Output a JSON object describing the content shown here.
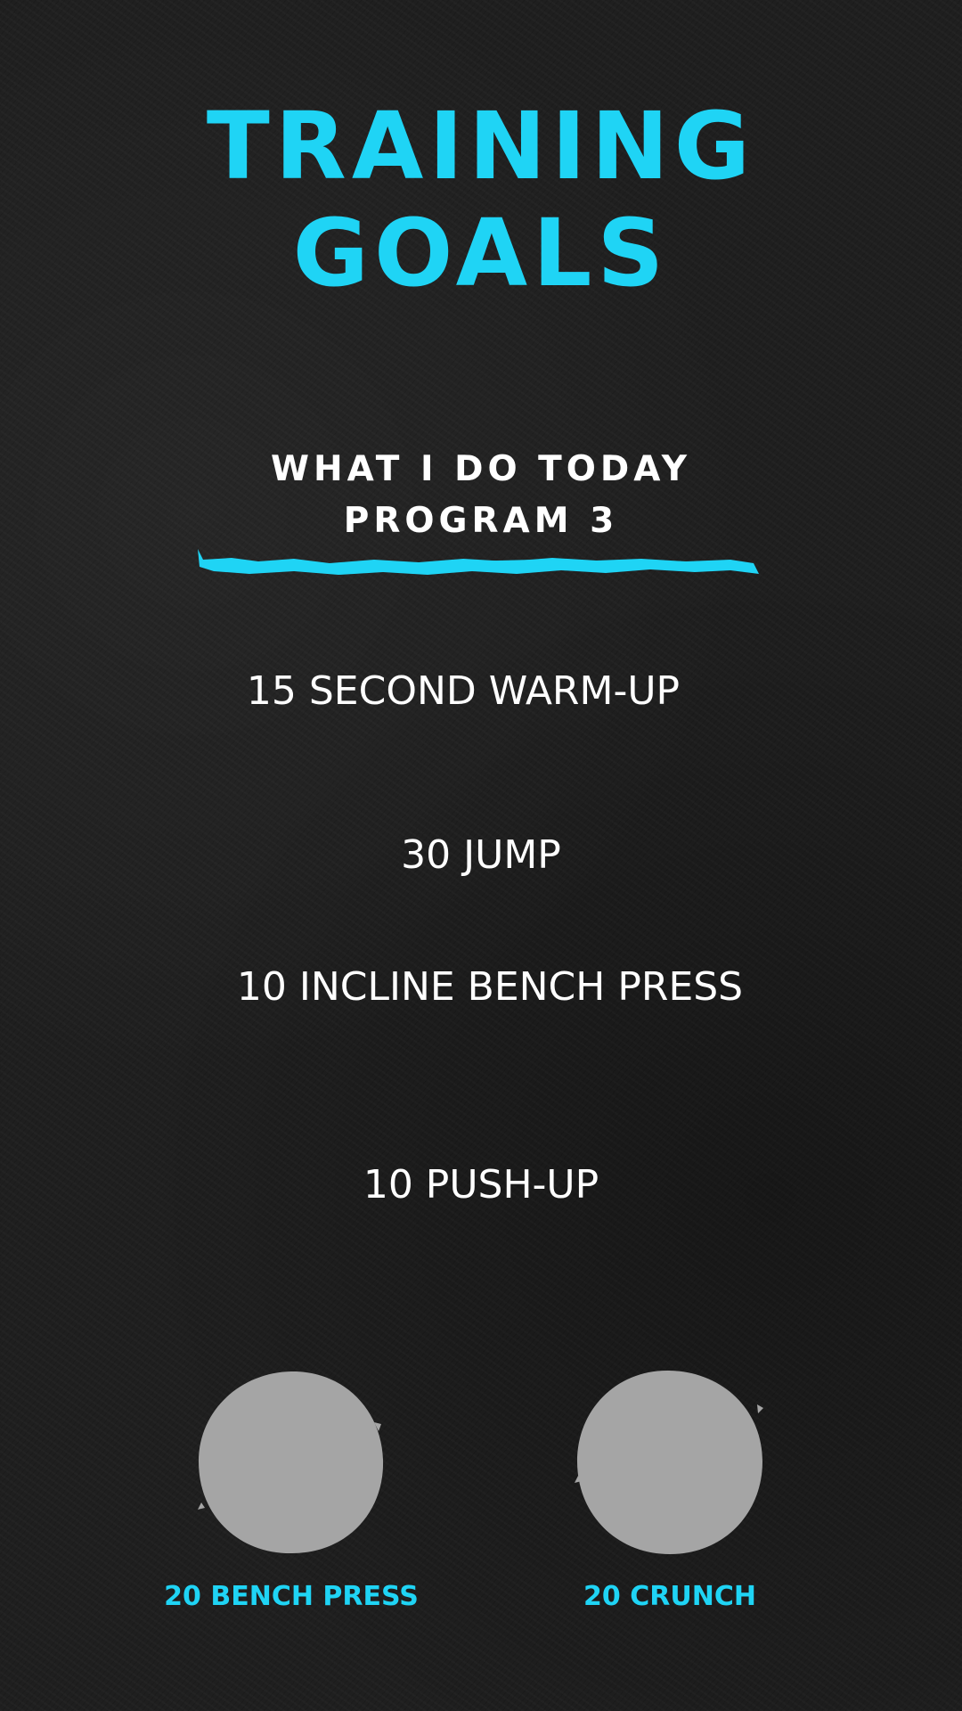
{
  "title": {
    "line1": "TRAINING",
    "line2": "GOALS"
  },
  "subtitle": {
    "line1": "WHAT I DO TODAY",
    "line2": "PROGRAM 3"
  },
  "exercises": [
    "15 SECOND WARM-UP",
    "30 JUMP",
    "10 INCLINE BENCH PRESS",
    "10 PUSH-UP"
  ],
  "highlights": [
    {
      "label": "20 BENCH PRESS"
    },
    {
      "label": "20 CRUNCH"
    }
  ],
  "colors": {
    "accent": "#1fd4f5",
    "background": "#1f1f1f",
    "text": "#ffffff",
    "placeholder_circle": "#a5a5a5"
  }
}
